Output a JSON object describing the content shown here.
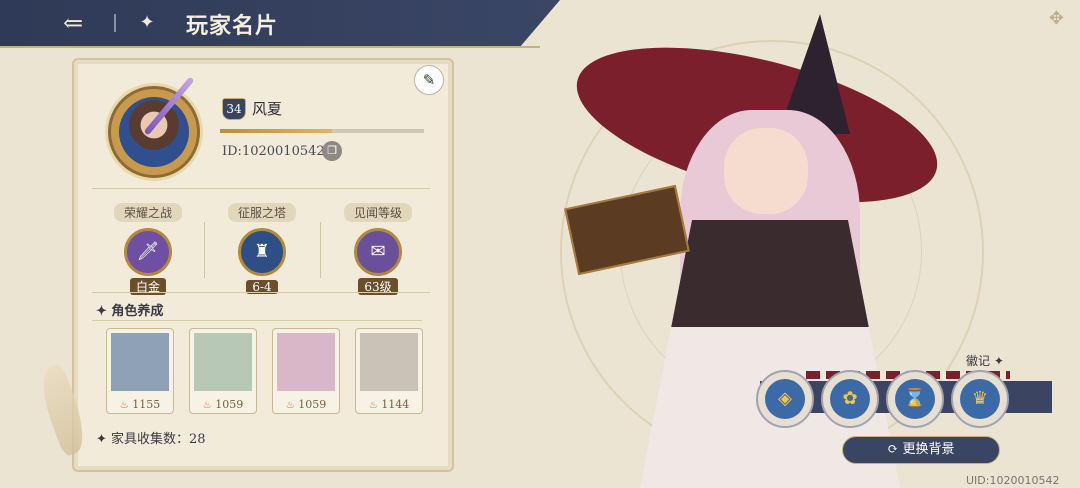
{
  "header": {
    "title": "玩家名片",
    "back_icon": "back-arrow-icon",
    "menu_icon": "grid-icon"
  },
  "profile": {
    "level": "34",
    "name": "风夏",
    "exp_progress": 0.55,
    "id": "ID:1020010542"
  },
  "stats": [
    {
      "label": "荣耀之战",
      "value": "白金",
      "icon": "sword-medal-icon"
    },
    {
      "label": "征服之塔",
      "value": "6-4",
      "icon": "tower-medal-icon"
    },
    {
      "label": "见闻等级",
      "value": "63级",
      "icon": "scroll-medal-icon"
    }
  ],
  "characters": {
    "section_title": "角色养成",
    "items": [
      {
        "power": "1155"
      },
      {
        "power": "1059"
      },
      {
        "power": "1059"
      },
      {
        "power": "1144"
      }
    ]
  },
  "furniture": {
    "text": "家具收集数：28"
  },
  "badges": {
    "label": "徽记"
  },
  "change_background": {
    "label": "更换背景"
  },
  "uid": "UID:1020010542",
  "colors": {
    "header_bg": "#2f3a57",
    "accent_gold": "#c89b4c",
    "button_bg": "#3a4563"
  }
}
